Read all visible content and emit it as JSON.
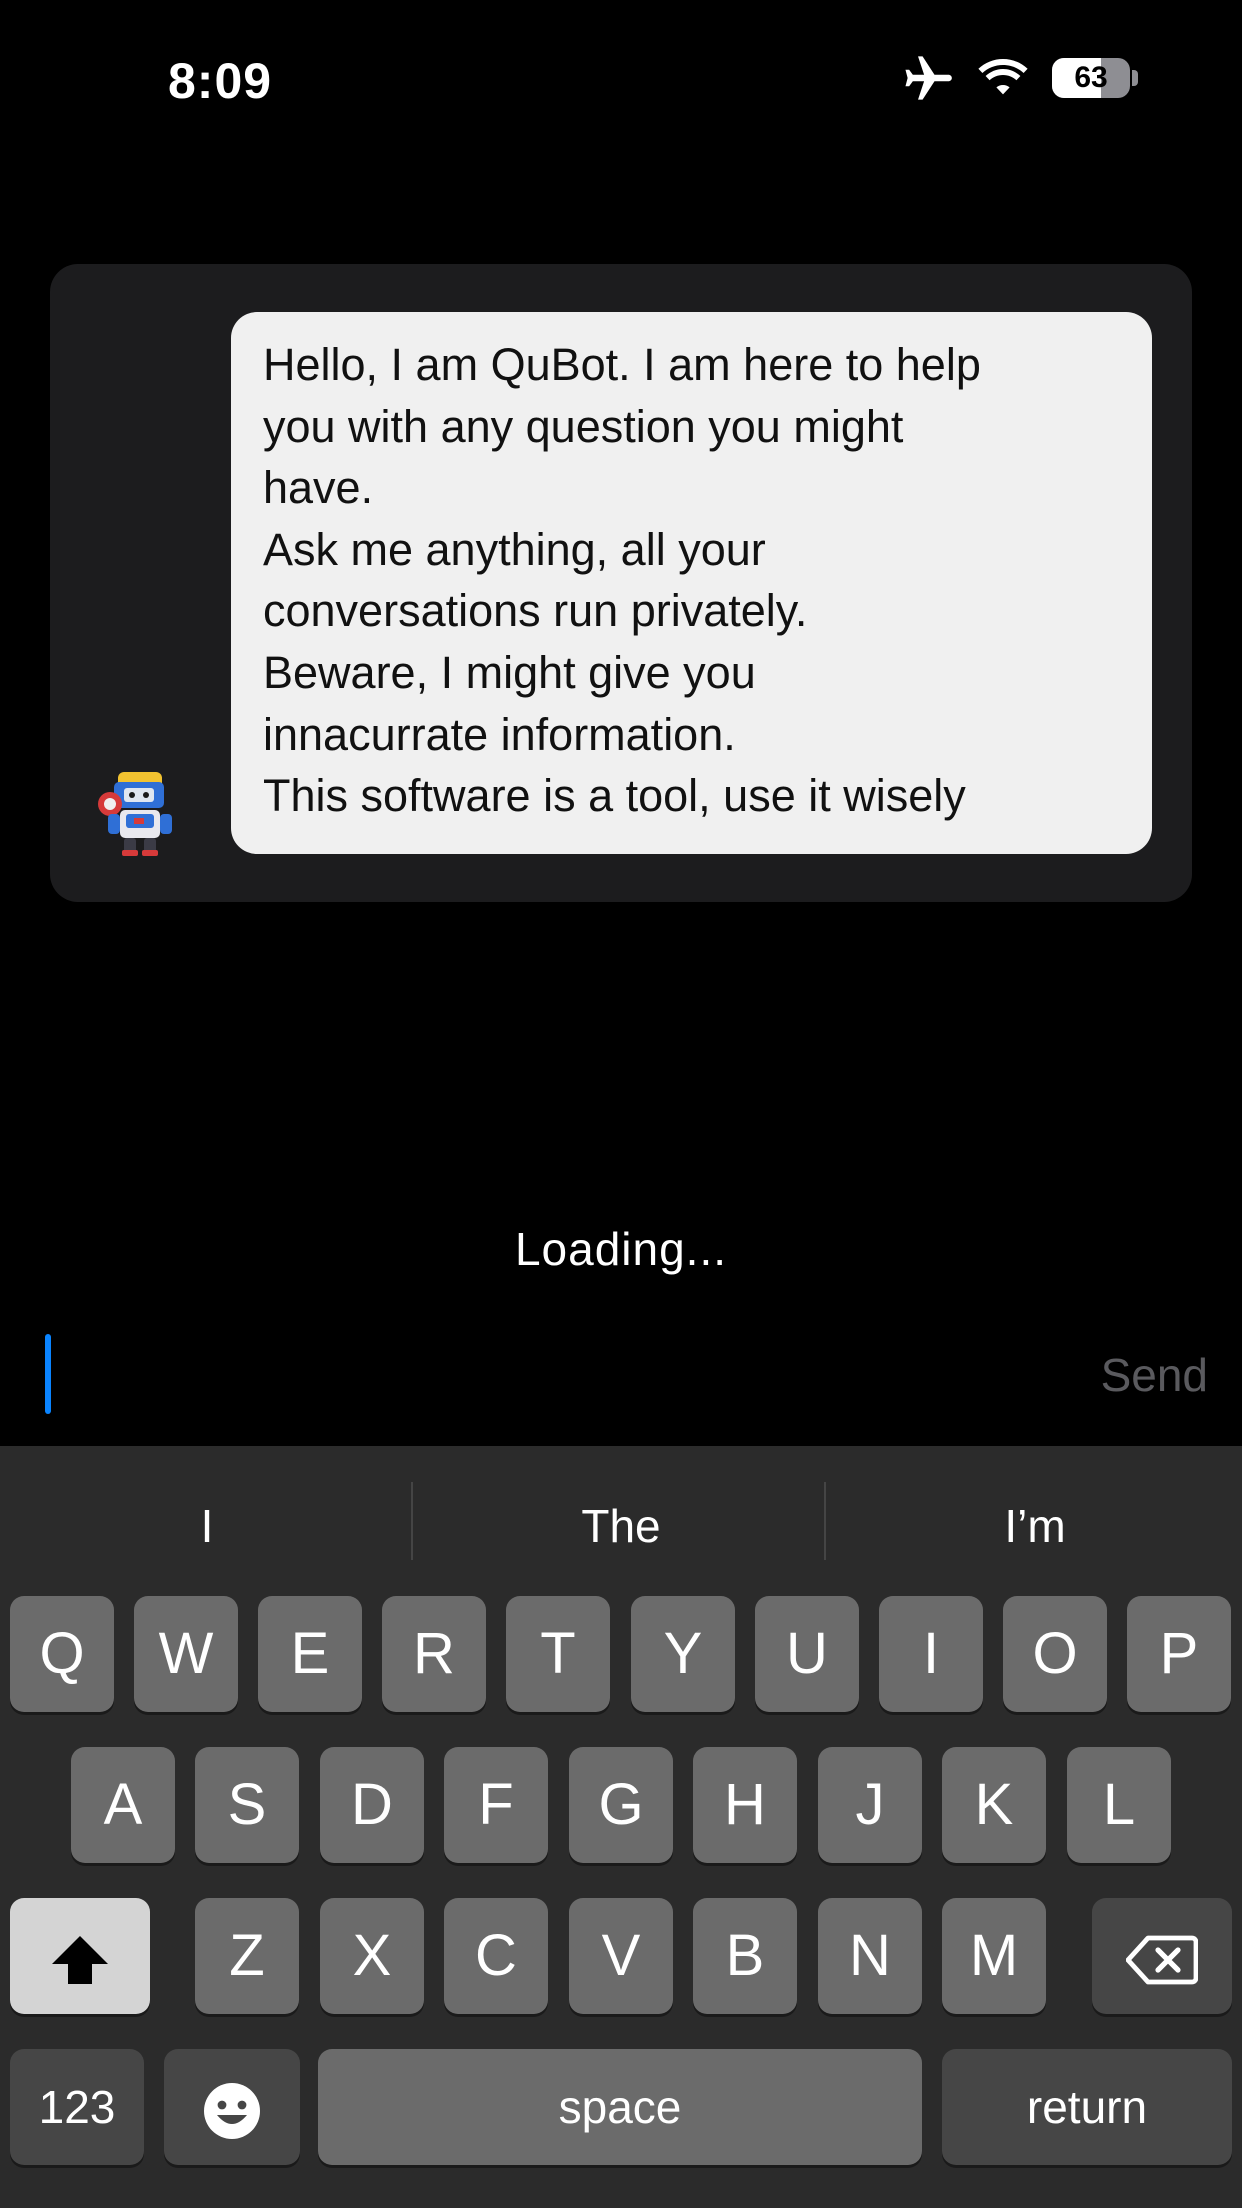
{
  "status_bar": {
    "time": "8:09",
    "battery_percent": "63",
    "battery_level": 0.63,
    "icons": [
      "airplane-icon",
      "wifi-icon",
      "battery-icon"
    ]
  },
  "chat": {
    "bot_avatar": "robot-avatar",
    "message_lines": [
      "Hello, I am QuBot. I am here to help",
      "you with any question you might",
      "have.",
      "Ask me anything, all your",
      "conversations run privately.",
      "Beware, I might give you",
      "innacurrate information.",
      "This software is a tool, use it wisely"
    ]
  },
  "status": {
    "loading": "Loading..."
  },
  "input": {
    "value": "",
    "send_label": "Send"
  },
  "keyboard": {
    "suggestions": [
      "I",
      "The",
      "I’m"
    ],
    "row1": [
      "Q",
      "W",
      "E",
      "R",
      "T",
      "Y",
      "U",
      "I",
      "O",
      "P"
    ],
    "row2": [
      "A",
      "S",
      "D",
      "F",
      "G",
      "H",
      "J",
      "K",
      "L"
    ],
    "row3": [
      "Z",
      "X",
      "C",
      "V",
      "B",
      "N",
      "M"
    ],
    "numbers_label": "123",
    "space_label": "space",
    "return_label": "return"
  },
  "colors": {
    "accent": "#0a84ff",
    "bubble": "#f0f0f0",
    "card": "#1c1c1e",
    "keyboard_bg": "#2b2b2b",
    "key": "#6b6b6b"
  }
}
